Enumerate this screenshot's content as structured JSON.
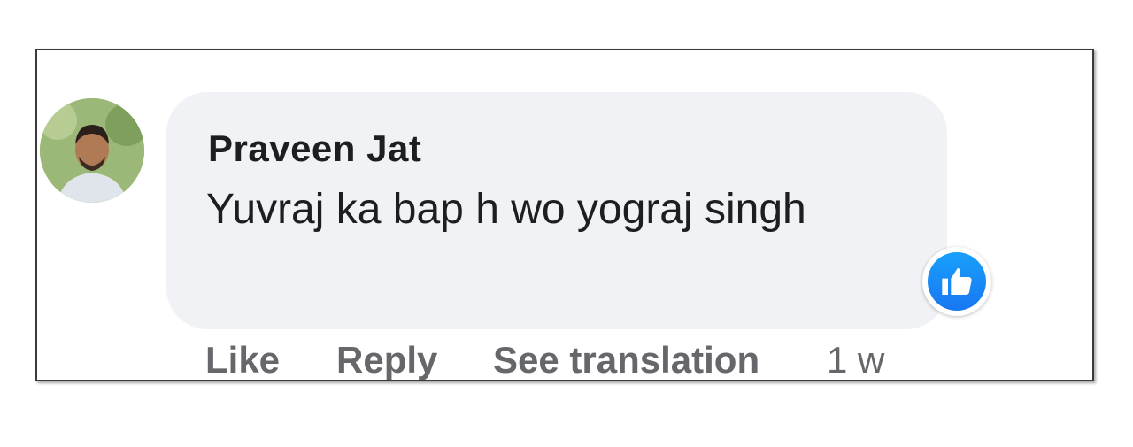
{
  "comment": {
    "author": "Praveen Jat",
    "text": "Yuvraj ka bap h wo yograj singh",
    "reaction_icon": "like-reaction-icon",
    "accent_color": "#1877f2"
  },
  "actions": {
    "like": "Like",
    "reply": "Reply",
    "see_translation": "See translation",
    "timestamp": "1 w"
  }
}
